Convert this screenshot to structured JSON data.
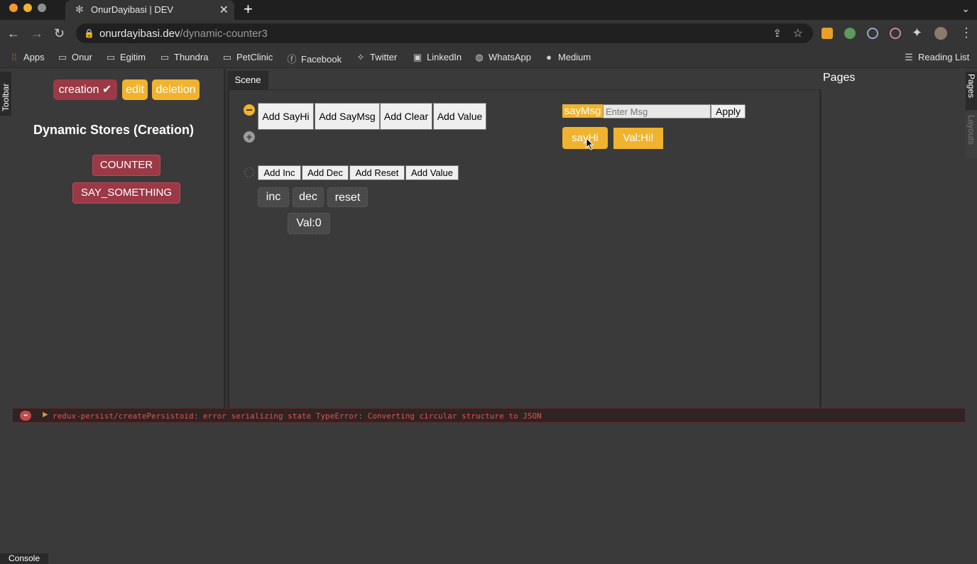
{
  "browser": {
    "tab_title": "OnurDayibasi | DEV",
    "tab_close": "✕",
    "new_tab": "+",
    "url_domain": "onurdayibasi.dev",
    "url_path": "/dynamic-counter3",
    "bookmarks": [
      "Apps",
      "Onur",
      "Egitim",
      "Thundra",
      "PetClinic",
      "Facebook",
      "Twitter",
      "LinkedIn",
      "WhatsApp",
      "Medium"
    ],
    "reading_list": "Reading List"
  },
  "side_tabs": {
    "toolbar": "Toolbar",
    "pages": "Pages",
    "layouts": "Layouts",
    "console": "Console"
  },
  "left_panel": {
    "modes": {
      "creation": "creation",
      "creation_check": "✔",
      "edit": "edit",
      "deletion": "deletion"
    },
    "title": "Dynamic Stores (Creation)",
    "stores": [
      "COUNTER",
      "SAY_SOMETHING"
    ]
  },
  "scene": {
    "tab": "Scene",
    "group1_buttons": [
      "Add SayHi",
      "Add SayMsg",
      "Add Clear",
      "Add Value"
    ],
    "group2_buttons": [
      "Add Inc",
      "Add Dec",
      "Add Reset",
      "Add Value"
    ],
    "counter_controls": [
      "inc",
      "dec",
      "reset"
    ],
    "counter_value": "Val:0",
    "say_msg_label": "sayMsg",
    "say_msg_placeholder": "Enter Msg",
    "apply": "Apply",
    "say_hi": "sayHi",
    "say_value": "Val:Hi!"
  },
  "pages_panel": {
    "title": "Pages"
  },
  "console": {
    "error": "redux-persist/createPersistoid: error serializing state TypeError: Converting circular structure to JSON"
  },
  "colors": {
    "orange": "#f0b32e",
    "crimson": "#9b3946",
    "background": "#3a3a3a"
  }
}
